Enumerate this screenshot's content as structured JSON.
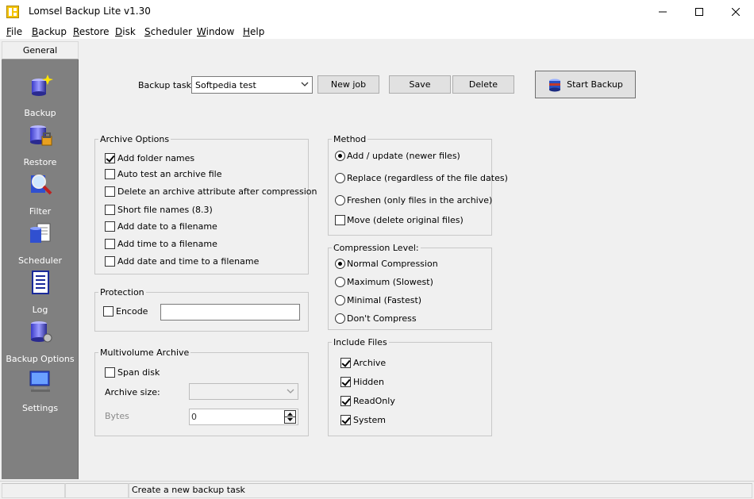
{
  "window": {
    "title": "Lomsel Backup Lite v1.30"
  },
  "menu": {
    "items": [
      {
        "key": "F",
        "rest": "ile"
      },
      {
        "key": "B",
        "rest": "ackup"
      },
      {
        "key": "R",
        "rest": "estore"
      },
      {
        "key": "D",
        "rest": "isk"
      },
      {
        "key": "S",
        "rest": "cheduler"
      },
      {
        "key": "W",
        "rest": "indow"
      },
      {
        "key": "H",
        "rest": "elp"
      }
    ]
  },
  "sidebar": {
    "tab": "General",
    "items": [
      {
        "label": "Backup",
        "icon": "backup-icon"
      },
      {
        "label": "Restore",
        "icon": "restore-icon"
      },
      {
        "label": "Filter",
        "icon": "filter-icon"
      },
      {
        "label": "Scheduler",
        "icon": "scheduler-icon"
      },
      {
        "label": "Log",
        "icon": "log-icon"
      },
      {
        "label": "Backup Options",
        "icon": "backup-options-icon"
      },
      {
        "label": "Settings",
        "icon": "settings-icon"
      }
    ]
  },
  "toolbar": {
    "task_label": "Backup task:",
    "task_value": "Softpedia test",
    "new_job": "New job",
    "save": "Save",
    "delete": "Delete",
    "start_backup": "Start Backup"
  },
  "archive_options": {
    "title": "Archive Options",
    "items": [
      {
        "label": "Add folder names",
        "checked": true
      },
      {
        "label": "Auto test an archive file",
        "checked": false
      },
      {
        "label": "Delete an archive attribute after compression",
        "checked": false
      },
      {
        "label": "Short file names (8.3)",
        "checked": false
      },
      {
        "label": "Add date to a filename",
        "checked": false
      },
      {
        "label": "Add time to a filename",
        "checked": false
      },
      {
        "label": "Add date and time to a filename",
        "checked": false
      }
    ]
  },
  "protection": {
    "title": "Protection",
    "encode_label": "Encode",
    "encode_checked": false,
    "password": ""
  },
  "multivolume": {
    "title": "Multivolume Archive",
    "span_label": "Span disk",
    "span_checked": false,
    "size_label": "Archive size:",
    "size_value": "",
    "bytes_label": "Bytes",
    "bytes_value": "0"
  },
  "method": {
    "title": "Method",
    "options": [
      {
        "label": "Add / update (newer files)",
        "selected": true
      },
      {
        "label": "Replace (regardless of the file dates)",
        "selected": false
      },
      {
        "label": "Freshen (only files in the archive)",
        "selected": false
      }
    ],
    "move_label": "Move (delete original files)",
    "move_checked": false
  },
  "compression": {
    "title": "Compression Level:",
    "options": [
      {
        "label": "Normal Compression",
        "selected": true
      },
      {
        "label": "Maximum (Slowest)",
        "selected": false
      },
      {
        "label": "Minimal (Fastest)",
        "selected": false
      },
      {
        "label": "Don't Compress",
        "selected": false
      }
    ]
  },
  "include_files": {
    "title": "Include Files",
    "items": [
      {
        "label": "Archive",
        "checked": true
      },
      {
        "label": "Hidden",
        "checked": true
      },
      {
        "label": "ReadOnly",
        "checked": true
      },
      {
        "label": "System",
        "checked": true
      }
    ]
  },
  "status": {
    "text": "Create a new backup task"
  },
  "colors": {
    "sidebar_bg": "#808080",
    "window_bg": "#f0f0f0",
    "start_icon": "#c0392b"
  }
}
